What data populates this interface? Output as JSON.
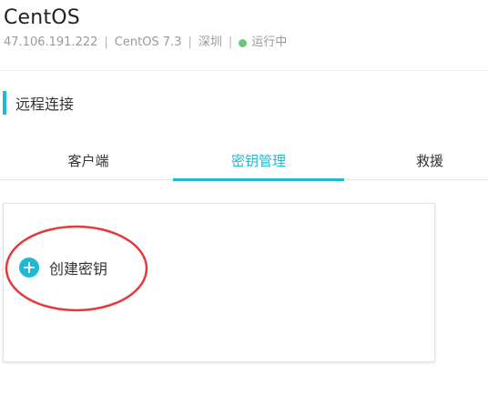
{
  "server": {
    "name": "CentOS",
    "ip": "47.106.191.222",
    "os": "CentOS 7.3",
    "region": "深圳",
    "status": "运行中",
    "status_color": "#6cc77a",
    "separator": "|"
  },
  "section": {
    "title": "远程连接"
  },
  "tabs": [
    {
      "label": "客户端",
      "active": false
    },
    {
      "label": "密钥管理",
      "active": true
    },
    {
      "label": "救援",
      "active": false
    }
  ],
  "panel": {
    "create_key_label": "创建密钥",
    "create_key_icon": "plus-circle-icon"
  },
  "colors": {
    "accent": "#1eb9d2",
    "annotation": "#e23a3a"
  }
}
